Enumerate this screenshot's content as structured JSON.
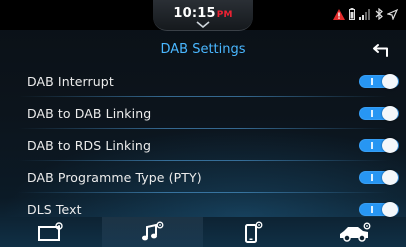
{
  "status_bar": {
    "time": "10:15",
    "ampm": "PM",
    "icons": [
      "warning-icon",
      "battery-icon",
      "signal-icon",
      "bluetooth-icon",
      "navigation-icon"
    ]
  },
  "header": {
    "title": "DAB Settings",
    "back_icon": "back-arrow-icon"
  },
  "settings": {
    "items": [
      {
        "label": "DAB Interrupt",
        "on": true
      },
      {
        "label": "DAB to DAB Linking",
        "on": true
      },
      {
        "label": "DAB to RDS Linking",
        "on": true
      },
      {
        "label": "DAB Programme Type (PTY)",
        "on": true
      },
      {
        "label": "DLS Text",
        "on": true
      }
    ]
  },
  "bottom_nav": {
    "items": [
      {
        "icon": "screen-settings-icon",
        "active": false
      },
      {
        "icon": "audio-settings-icon",
        "active": true
      },
      {
        "icon": "phone-settings-icon",
        "active": false
      },
      {
        "icon": "vehicle-settings-icon",
        "active": false
      }
    ]
  },
  "colors": {
    "accent": "#2796f3",
    "title": "#4ab7ff",
    "warning": "#e22b2b"
  }
}
